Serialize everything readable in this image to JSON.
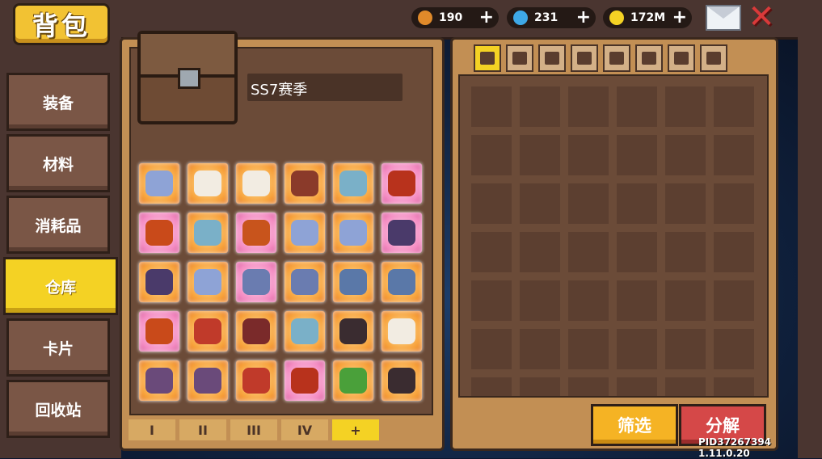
{
  "title": "背包",
  "currencies": [
    {
      "name": "energy",
      "value": "190",
      "color": "#e08a2a"
    },
    {
      "name": "gems",
      "value": "231",
      "color": "#3ea8e6"
    },
    {
      "name": "gold",
      "value": "172M",
      "color": "#f4d224"
    }
  ],
  "tabs": [
    "装备",
    "材料",
    "消耗品",
    "仓库",
    "卡片",
    "回收站"
  ],
  "active_tab": "仓库",
  "storage": {
    "name": "SS7赛季",
    "pages": [
      "I",
      "II",
      "III",
      "IV",
      "+"
    ],
    "selected_page": "+"
  },
  "items": [
    {
      "icon": "ice-armor-icon",
      "rarity": "orange",
      "color": "#8ea3d6"
    },
    {
      "icon": "white-cloud-icon",
      "rarity": "orange",
      "color": "#f2ece2"
    },
    {
      "icon": "white-cloud-icon",
      "rarity": "orange",
      "color": "#f2ece2"
    },
    {
      "icon": "red-egg-icon",
      "rarity": "orange",
      "color": "#8a3a2a"
    },
    {
      "icon": "blue-boots-icon",
      "rarity": "orange",
      "color": "#7ab0c8"
    },
    {
      "icon": "fire-armor-icon",
      "rarity": "pink",
      "color": "#b8321c"
    },
    {
      "icon": "fire-staff-icon",
      "rarity": "pink",
      "color": "#c94a1a"
    },
    {
      "icon": "blue-boots-icon",
      "rarity": "orange",
      "color": "#7ab0c8"
    },
    {
      "icon": "crossed-blades-icon",
      "rarity": "pink",
      "color": "#c8541c"
    },
    {
      "icon": "ice-armor-icon",
      "rarity": "orange",
      "color": "#8ea3d6"
    },
    {
      "icon": "ice-armor-icon",
      "rarity": "orange",
      "color": "#8ea3d6"
    },
    {
      "icon": "dark-wings-icon",
      "rarity": "pink",
      "color": "#4a3a6a"
    },
    {
      "icon": "dark-wings-icon",
      "rarity": "orange",
      "color": "#4a3a6a"
    },
    {
      "icon": "ice-armor-icon",
      "rarity": "orange",
      "color": "#8ea3d6"
    },
    {
      "icon": "mushroom-helm-icon",
      "rarity": "pink",
      "color": "#6a7cb0"
    },
    {
      "icon": "mushroom-helm-icon",
      "rarity": "orange",
      "color": "#6a7cb0"
    },
    {
      "icon": "shell-icon",
      "rarity": "orange",
      "color": "#5a78a8"
    },
    {
      "icon": "shell-icon",
      "rarity": "orange",
      "color": "#5a78a8"
    },
    {
      "icon": "fire-staff-icon",
      "rarity": "pink",
      "color": "#c94a1a"
    },
    {
      "icon": "red-chest-icon",
      "rarity": "orange",
      "color": "#c03a2a"
    },
    {
      "icon": "horned-armor-icon",
      "rarity": "orange",
      "color": "#7a2a2a"
    },
    {
      "icon": "blue-boots-icon",
      "rarity": "orange",
      "color": "#7ab0c8"
    },
    {
      "icon": "dark-helmet-icon",
      "rarity": "orange",
      "color": "#3a2c30"
    },
    {
      "icon": "white-cloud-icon",
      "rarity": "orange",
      "color": "#f2ece2"
    },
    {
      "icon": "purple-mask-icon",
      "rarity": "orange",
      "color": "#6a4a7a"
    },
    {
      "icon": "purple-mask-icon",
      "rarity": "orange",
      "color": "#6a4a7a"
    },
    {
      "icon": "red-chest-icon",
      "rarity": "orange",
      "color": "#c03a2a"
    },
    {
      "icon": "fire-armor-icon",
      "rarity": "pink",
      "color": "#b8321c"
    },
    {
      "icon": "green-leaf-icon",
      "rarity": "orange",
      "color": "#4aa03a"
    },
    {
      "icon": "dark-helmet-icon",
      "rarity": "orange",
      "color": "#3a2c30"
    }
  ],
  "filter_tabs": [
    "all-grid-icon",
    "sword-icon",
    "armor-icon",
    "helmet-icon",
    "boots-icon",
    "ring-icon",
    "amulet-icon",
    "gear-icon"
  ],
  "buttons": {
    "filter": "筛选",
    "decompose": "分解"
  },
  "pid": "PID37267394 1.11.0.20"
}
